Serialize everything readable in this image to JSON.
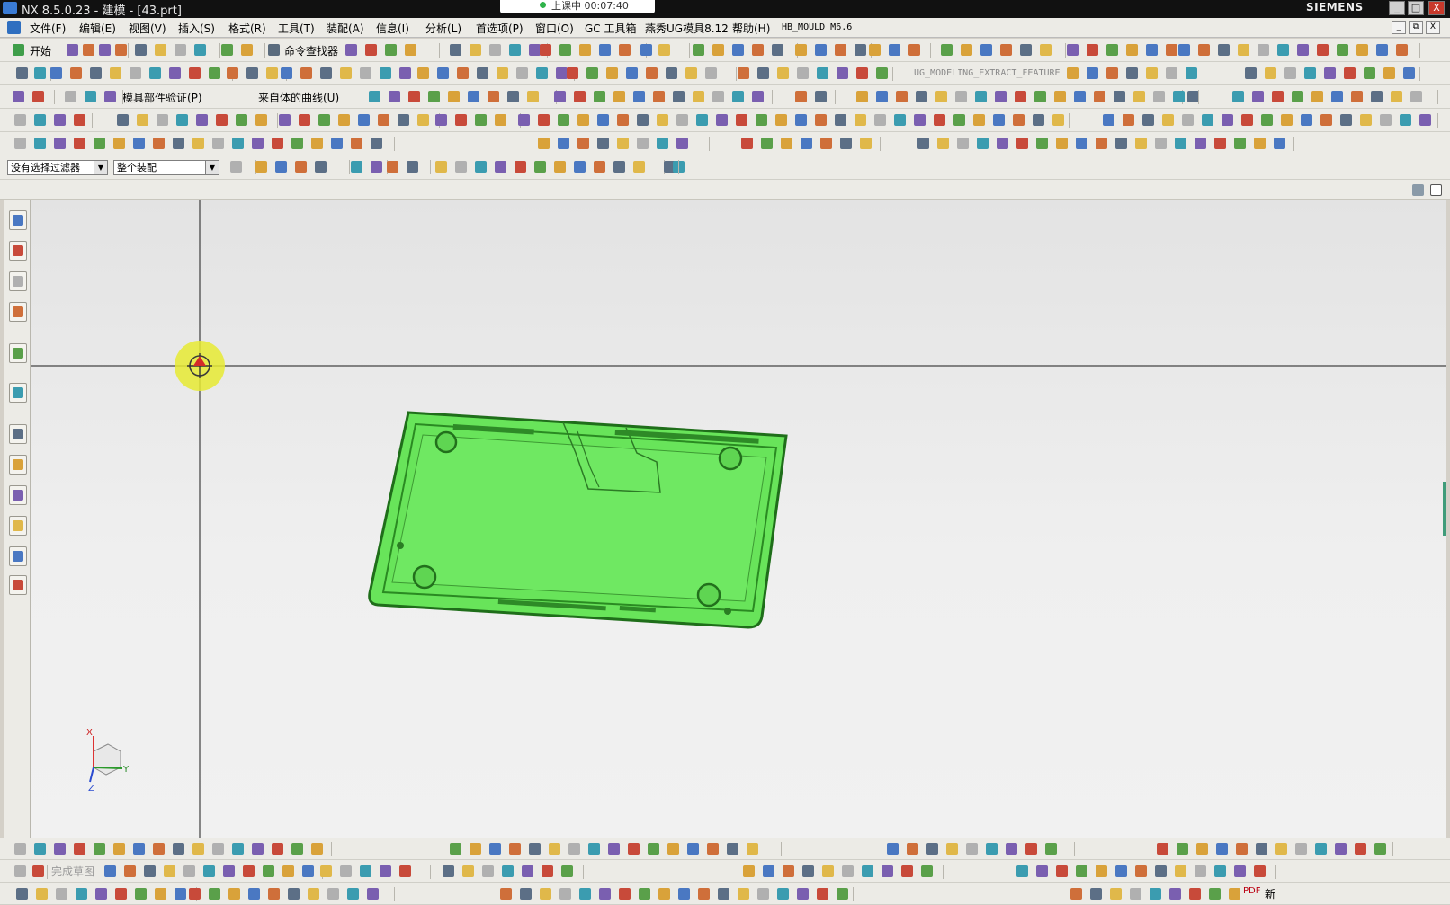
{
  "window": {
    "title": "NX 8.5.0.23 - 建模 - [43.prt]",
    "recording": "上课中 00:07:40",
    "brand": "SIEMENS",
    "controls": [
      "_",
      "□",
      "X"
    ]
  },
  "menubar": {
    "items": [
      "文件(F)",
      "编辑(E)",
      "视图(V)",
      "插入(S)",
      "格式(R)",
      "工具(T)",
      "装配(A)",
      "信息(I)",
      "分析(L)",
      "首选项(P)",
      "窗口(O)",
      "GC 工具箱",
      "燕秀UG模具8.12",
      "帮助(H)",
      "HB_MOULD M6.6"
    ],
    "mdi_controls": [
      "_",
      "⧉",
      "X"
    ]
  },
  "toolbar_standard": {
    "start_label": "开始",
    "command_finder_label": "命令查找器"
  },
  "toolbar_hint": "UG_MODELING_EXTRACT_FEATURE",
  "toolbar_mold": {
    "mold_part_verify_label": "模具部件验证(P)",
    "from_body_curve_label": "来自体的曲线(U)"
  },
  "selection_bar": {
    "filter_value": "没有选择过滤器",
    "scope_value": "整个装配"
  },
  "sketch_toolbar": {
    "finish_sketch_label": "完成草图"
  },
  "triad": {
    "x_label": "X",
    "y_label": "Y",
    "z_label": "Z"
  },
  "bottom_bar": {
    "pdf_label": "PDF",
    "new_label": "新"
  },
  "colors": {
    "part_fill": "#68e45a",
    "part_edge": "#1f6e1a",
    "highlight_ring": "#e6ea33",
    "crosshair": "#1a1a1a"
  }
}
